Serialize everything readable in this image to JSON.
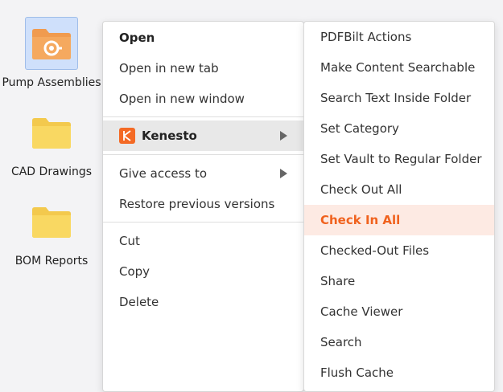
{
  "desktop": {
    "folders": [
      {
        "label": "Pump Assemblies",
        "icon": "gear-folder-icon",
        "selected": true,
        "color": "#f09b4f"
      },
      {
        "label": "CAD Drawings",
        "icon": "folder-icon",
        "selected": false,
        "color": "#f9d25d"
      },
      {
        "label": "BOM Reports",
        "icon": "folder-icon",
        "selected": false,
        "color": "#f9d25d"
      }
    ]
  },
  "context_menu": {
    "items": [
      {
        "label": "Open"
      },
      {
        "label": "Open in new tab"
      },
      {
        "label": "Open in new window"
      },
      {
        "label": "Kenesto"
      },
      {
        "label": "Give access to"
      },
      {
        "label": "Restore previous versions"
      },
      {
        "label": "Cut"
      },
      {
        "label": "Copy"
      },
      {
        "label": "Delete"
      }
    ]
  },
  "kenesto_submenu": {
    "items": [
      {
        "label": "PDFBilt Actions"
      },
      {
        "label": "Make Content Searchable"
      },
      {
        "label": "Search Text Inside Folder"
      },
      {
        "label": "Set Category"
      },
      {
        "label": "Set Vault to Regular Folder"
      },
      {
        "label": "Check Out All"
      },
      {
        "label": "Check In All"
      },
      {
        "label": "Checked-Out Files"
      },
      {
        "label": "Share"
      },
      {
        "label": "Cache Viewer"
      },
      {
        "label": "Search"
      },
      {
        "label": "Flush Cache"
      }
    ],
    "active_color": "#f0621e"
  }
}
